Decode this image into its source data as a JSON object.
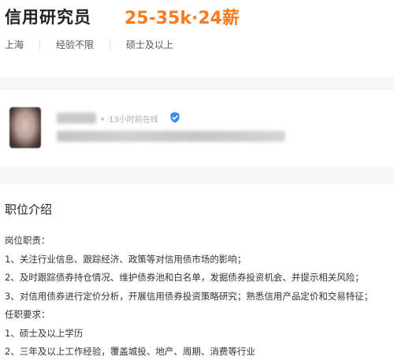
{
  "job": {
    "title": "信用研究员",
    "salary": "25-35k·24薪",
    "tags": [
      "上海",
      "经验不限",
      "硕士及以上"
    ]
  },
  "recruiter": {
    "online_status": "13小时前在线",
    "verify_icon": "verified-badge-icon"
  },
  "description": {
    "section_title": "职位介绍",
    "lines": [
      "岗位职责：",
      "1、关注行业信息、跟踪经济、政策等对信用债市场的影响；",
      "2、及时跟踪债券持仓情况、维护债券池和白名单，发掘债券投资机会、并提示相关风险；",
      "3、对信用债券进行定价分析，开展信用债券投资策略研究；熟悉信用产品定价和交易特征；",
      "任职要求：",
      "1、硕士及以上学历",
      "2、三年及以上工作经验，覆盖城投、地产、周期、消费等行业"
    ]
  },
  "colors": {
    "salary": "#ff7a1a",
    "verify": "#3b8ef0",
    "band": "#f6f6f6"
  }
}
